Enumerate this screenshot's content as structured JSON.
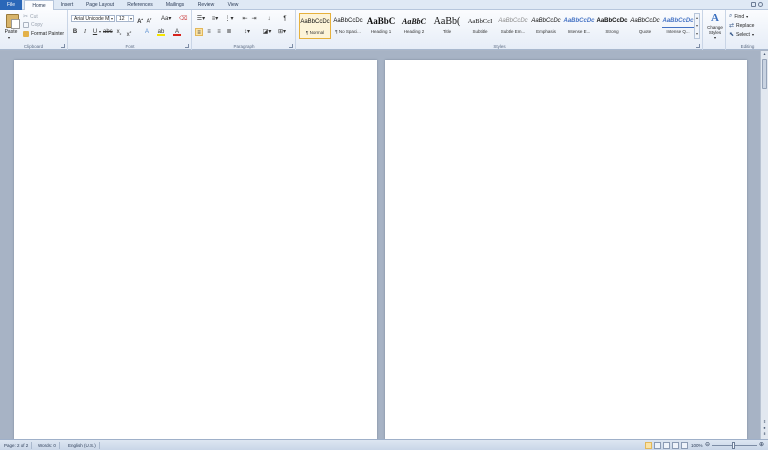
{
  "tabs": [
    "File",
    "Home",
    "Insert",
    "Page Layout",
    "References",
    "Mailings",
    "Review",
    "View"
  ],
  "clipboard": {
    "paste_label": "Paste",
    "cut_label": "Cut",
    "copy_label": "Copy",
    "format_painter_label": "Format Painter",
    "group_label": "Clipboard"
  },
  "font": {
    "font_name": "Arial Unicode M",
    "font_size": "12",
    "group_label": "Font"
  },
  "paragraph": {
    "group_label": "Paragraph"
  },
  "styles": {
    "group_label": "Styles",
    "items": [
      {
        "sample": "AaBbCcDc",
        "name": "¶ Normal"
      },
      {
        "sample": "AaBbCcDc",
        "name": "¶ No Spaci..."
      },
      {
        "sample": "AaBbC",
        "name": "Heading 1"
      },
      {
        "sample": "AaBbC",
        "name": "Heading 2"
      },
      {
        "sample": "AaBb(",
        "name": "Title"
      },
      {
        "sample": "AaBbCcI",
        "name": "Subtitle"
      },
      {
        "sample": "AaBbCcDc",
        "name": "Subtle Em..."
      },
      {
        "sample": "AaBbCcDc",
        "name": "Emphasis"
      },
      {
        "sample": "AaBbCcDc",
        "name": "Intense E..."
      },
      {
        "sample": "AaBbCcDc",
        "name": "Strong"
      },
      {
        "sample": "AaBbCcDc",
        "name": "Quote"
      },
      {
        "sample": "AaBbCcDc",
        "name": "Intense Q..."
      }
    ],
    "change_styles_label": "Change Styles"
  },
  "editing": {
    "find_label": "Find",
    "replace_label": "Replace",
    "select_label": "Select",
    "group_label": "Editing"
  },
  "status": {
    "page": "Page: 2 of 2",
    "words": "Words: 0",
    "language": "English (U.S.)",
    "zoom": "100%"
  },
  "colors": {
    "file_tab": "#2a67b8",
    "selected": "#fbe3a4",
    "font_color": "#d6231c",
    "highlight": "#f5e400"
  }
}
